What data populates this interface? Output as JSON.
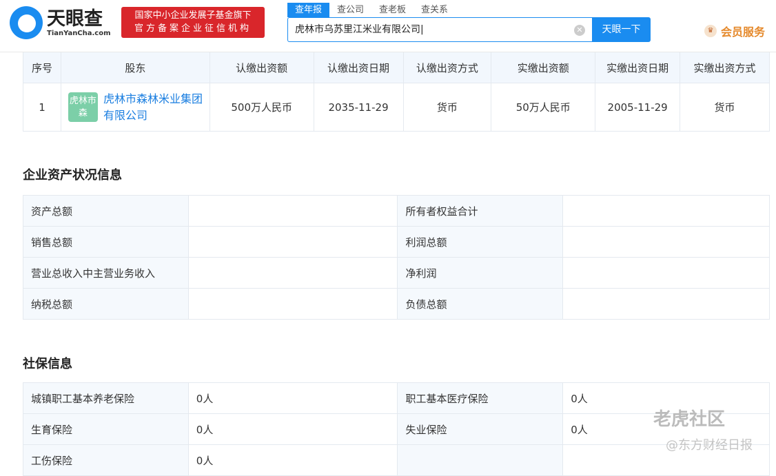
{
  "header": {
    "logo_cn": "天眼查",
    "logo_en": "TianYanCha.com",
    "badge_line1": "国家中小企业发展子基金旗下",
    "badge_line2": "官方备案企业征信机构",
    "tabs": [
      "查年报",
      "查公司",
      "查老板",
      "查关系"
    ],
    "search_value": "虎林市乌苏里江米业有限公司",
    "search_button": "天眼一下",
    "vip": "会员服务"
  },
  "shareholders": {
    "columns": [
      "序号",
      "股东",
      "认缴出资额",
      "认缴出资日期",
      "认缴出资方式",
      "实缴出资额",
      "实缴出资日期",
      "实缴出资方式"
    ],
    "rows": [
      {
        "no": "1",
        "avatar": "虎林市森",
        "name": "虎林市森林米业集团有限公司",
        "sub_amount": "500万人民币",
        "sub_date": "2035-11-29",
        "sub_method": "货币",
        "paid_amount": "50万人民币",
        "paid_date": "2005-11-29",
        "paid_method": "货币"
      }
    ]
  },
  "assets": {
    "title": "企业资产状况信息",
    "rows": [
      {
        "l1": "资产总额",
        "v1": "",
        "l2": "所有者权益合计",
        "v2": ""
      },
      {
        "l1": "销售总额",
        "v1": "",
        "l2": "利润总额",
        "v2": ""
      },
      {
        "l1": "营业总收入中主营业务收入",
        "v1": "",
        "l2": "净利润",
        "v2": ""
      },
      {
        "l1": "纳税总额",
        "v1": "",
        "l2": "负债总额",
        "v2": ""
      }
    ]
  },
  "social": {
    "title": "社保信息",
    "rows": [
      {
        "l1": "城镇职工基本养老保险",
        "v1": "0人",
        "l2": "职工基本医疗保险",
        "v2": "0人"
      },
      {
        "l1": "生育保险",
        "v1": "0人",
        "l2": "失业保险",
        "v2": "0人"
      },
      {
        "l1": "工伤保险",
        "v1": "0人",
        "l2": "",
        "v2": ""
      }
    ]
  },
  "watermark": {
    "line1": "老虎社区",
    "line2": "@东方财经日报"
  }
}
